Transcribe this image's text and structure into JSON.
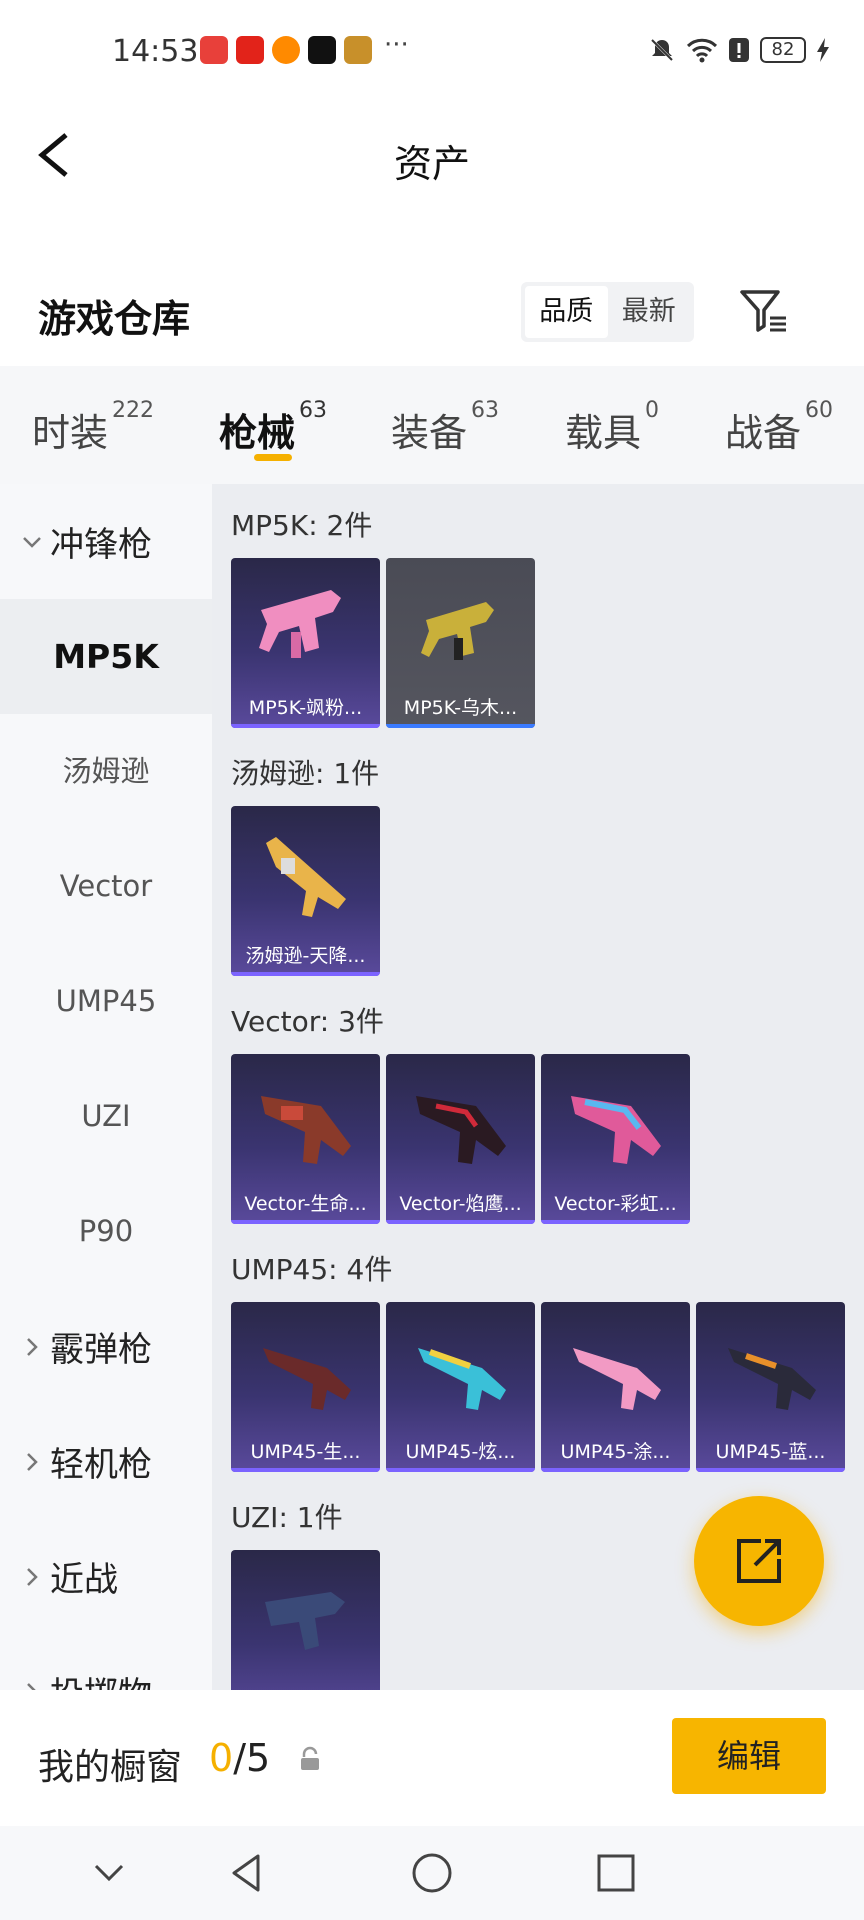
{
  "status_bar": {
    "time": "14:53",
    "more": "···",
    "battery": "82",
    "icons": [
      "huawei-app-icon",
      "netease-music-icon",
      "taobao-icon",
      "tiktok-icon",
      "game-app-icon",
      "mute-icon",
      "wifi-icon",
      "alert-icon",
      "battery-icon",
      "charging-icon"
    ]
  },
  "title_bar": {
    "title": "资产"
  },
  "heading": {
    "title": "游戏仓库",
    "sort_options": [
      "品质",
      "最新"
    ],
    "active_sort": "品质"
  },
  "tabs": [
    {
      "label": "时装",
      "count": "222"
    },
    {
      "label": "枪械",
      "count": "63",
      "active": true
    },
    {
      "label": "装备",
      "count": "63"
    },
    {
      "label": "载具",
      "count": "0"
    },
    {
      "label": "战备",
      "count": "60"
    }
  ],
  "sidebar": {
    "categories": [
      "冲锋枪",
      "霰弹枪",
      "轻机枪",
      "近战",
      "投掷物"
    ],
    "subcategories": [
      "MP5K",
      "汤姆逊",
      "Vector",
      "UMP45",
      "UZI",
      "P90"
    ],
    "active_sub": "MP5K"
  },
  "groups": [
    {
      "title": "MP5K: 2件",
      "items": [
        "MP5K-飒粉...",
        "MP5K-乌木..."
      ]
    },
    {
      "title": "汤姆逊: 1件",
      "items": [
        "汤姆逊-天降..."
      ]
    },
    {
      "title": "Vector: 3件",
      "items": [
        "Vector-生命...",
        "Vector-焰鹰...",
        "Vector-彩虹..."
      ]
    },
    {
      "title": "UMP45: 4件",
      "items": [
        "UMP45-生...",
        "UMP45-炫...",
        "UMP45-涂...",
        "UMP45-蓝..."
      ]
    },
    {
      "title": "UZI: 1件",
      "items": [
        ""
      ]
    }
  ],
  "bottom": {
    "showcase_label": "我的橱窗",
    "showcase_current": "0",
    "showcase_total": "/5",
    "edit_label": "编辑"
  },
  "colors": {
    "accent": "#f7b500",
    "card_purple": "#3a3470",
    "card_dark": "#4a4b55"
  }
}
